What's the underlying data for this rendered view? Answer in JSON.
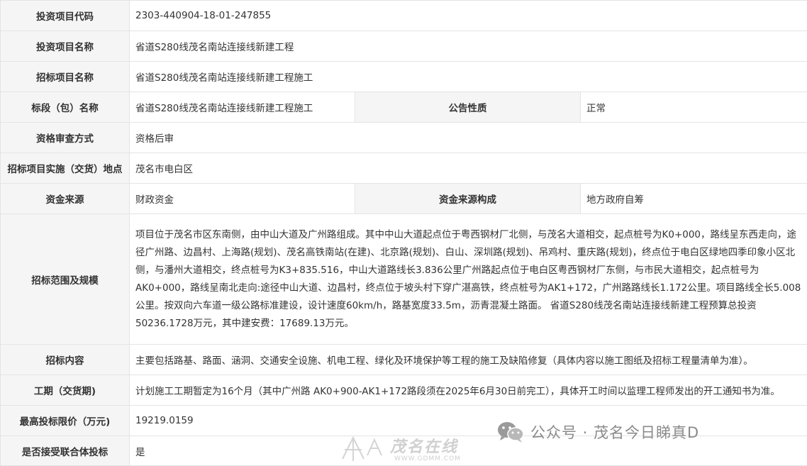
{
  "rows": {
    "project_code": {
      "label": "投资项目代码",
      "value": "2303-440904-18-01-247855"
    },
    "project_name": {
      "label": "投资项目名称",
      "value": "省道S280线茂名南站连接线新建工程"
    },
    "tender_name": {
      "label": "招标项目名称",
      "value": "省道S280线茂名南站连接线新建工程施工"
    },
    "section_name": {
      "label": "标段（包）名称",
      "value": "省道S280线茂名南站连接线新建工程施工"
    },
    "notice_type": {
      "label": "公告性质",
      "value": "正常"
    },
    "qualification": {
      "label": "资格审查方式",
      "value": "资格后审"
    },
    "location": {
      "label": "招标项目实施（交货）地点",
      "value": "茂名市电白区"
    },
    "fund_source": {
      "label": "资金来源",
      "value": "财政资金"
    },
    "fund_composition": {
      "label": "资金来源构成",
      "value": "地方政府自筹"
    },
    "scope": {
      "label": "招标范围及规模",
      "value": "项目位于茂名市区东南侧，由中山大道及广州路组成。其中中山大道起点位于粤西钢材厂北侧，与茂名大道相交，起点桩号为K0+000，路线呈东西走向，途径广州路、边昌村、上海路(规划)、茂名高铁南站(在建)、北京路(规划)、白山、深圳路(规划)、吊鸡村、重庆路(规划)，终点位于电白区绿地四季印象小区北侧，与潘州大道相交，终点桩号为K3+835.516，中山大道路线长3.836公里广州路起点位于电白区粤西钢材厂东侧，与市民大道相交，起点桩号为AK0+000，路线呈南北走向:途径中山大道、边昌村，终点位于坡头村下穿广湛高铁，终点桩号为AK1+172，广州路路线长1.172公里。项目路线全长5.008公里。按双向六车道一级公路标准建设，设计速度60km/h，路基宽度33.5m，沥青混凝土路面。 省道S280线茂名南站连接线新建工程预算总投资50236.1728万元，其中建安费：17689.13万元。"
    },
    "content": {
      "label": "招标内容",
      "value": "主要包括路基、路面、涵洞、交通安全设施、机电工程、绿化及环境保护等工程的施工及缺陷修复（具体内容以施工图纸及招标工程量清单为准）。"
    },
    "period": {
      "label": "工期（交货期)",
      "value": "计划施工工期暂定为16个月（其中广州路 AK0+900-AK1+172路段须在2025年6月30日前完工），具体开工时间以监理工程师发出的开工通知书为准。"
    },
    "max_price": {
      "label": "最高投标限价（万元)",
      "value": "19219.0159"
    },
    "consortium": {
      "label": "是否接受联合体投标",
      "value": "是"
    }
  },
  "watermark": {
    "account_text": "公众号 · 茂名今日睇真D",
    "icon": "wechat-icon",
    "site_logo_text": "茂名在线",
    "site_url": "WWW.GDMM.COM"
  }
}
